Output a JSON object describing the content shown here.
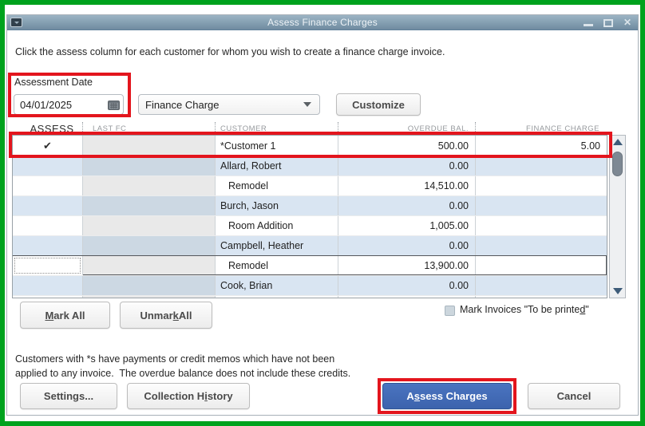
{
  "colors": {
    "frame_green": "#00a21d",
    "annotation_red": "#e3151d",
    "accent_blue": "#4a74c0",
    "row_alt_blue": "#d9e5f2"
  },
  "window": {
    "title": "Assess Finance Charges",
    "close_glyph": "✕"
  },
  "instruction": "Click the assess column for each customer for whom you wish to create a finance charge invoice.",
  "assessment": {
    "label": "Assessment Date",
    "date_value": "04/01/2025"
  },
  "charge_type": {
    "value": "Finance Charge"
  },
  "customize": {
    "label": "Customize",
    "underline_at": -1
  },
  "table": {
    "check_glyph": "✔",
    "columns": [
      "ASSESS",
      "LAST FC",
      "CUSTOMER",
      "OVERDUE BAL.",
      "FINANCE CHARGE"
    ],
    "rows": [
      {
        "assess": true,
        "last_fc": "",
        "customer": "*Customer 1",
        "overdue_bal": "500.00",
        "finance_charge": "5.00",
        "indent": false,
        "zebra": "white",
        "annotated": true
      },
      {
        "assess": false,
        "last_fc": "",
        "customer": "Allard, Robert",
        "overdue_bal": "0.00",
        "finance_charge": "",
        "indent": false,
        "zebra": "blue"
      },
      {
        "assess": false,
        "last_fc": "",
        "customer": "Remodel",
        "overdue_bal": "14,510.00",
        "finance_charge": "",
        "indent": true,
        "zebra": "white"
      },
      {
        "assess": false,
        "last_fc": "",
        "customer": "Burch, Jason",
        "overdue_bal": "0.00",
        "finance_charge": "",
        "indent": false,
        "zebra": "blue"
      },
      {
        "assess": false,
        "last_fc": "",
        "customer": "Room Addition",
        "overdue_bal": "1,005.00",
        "finance_charge": "",
        "indent": true,
        "zebra": "white"
      },
      {
        "assess": false,
        "last_fc": "",
        "customer": "Campbell, Heather",
        "overdue_bal": "0.00",
        "finance_charge": "",
        "indent": false,
        "zebra": "blue"
      },
      {
        "assess": false,
        "last_fc": "",
        "customer": "Remodel",
        "overdue_bal": "13,900.00",
        "finance_charge": "",
        "indent": true,
        "zebra": "white",
        "selected": true
      },
      {
        "assess": false,
        "last_fc": "",
        "customer": "Cook, Brian",
        "overdue_bal": "0.00",
        "finance_charge": "",
        "indent": false,
        "zebra": "blue"
      }
    ]
  },
  "bulk_actions": {
    "mark_all": {
      "label": "Mark All",
      "underline_at": 0
    },
    "unmark_all": {
      "label": "Unmark All",
      "underline_at": 5
    },
    "mark_invoices": {
      "label": "Mark Invoices \"To be printed\"",
      "underline_at": 27,
      "checked": false
    }
  },
  "note": {
    "line1": "Customers with *s have payments or credit memos which have not been",
    "line2": "applied to any invoice.  The overdue balance does not include these credits."
  },
  "footer": {
    "settings": {
      "label": "Settings...",
      "underline_at": 6
    },
    "collection_history": {
      "label": "Collection History",
      "underline_at": 12
    },
    "assess_charges": {
      "label": "Assess Charges",
      "underline_at": 1
    },
    "cancel": {
      "label": "Cancel",
      "underline_at": -1
    }
  }
}
